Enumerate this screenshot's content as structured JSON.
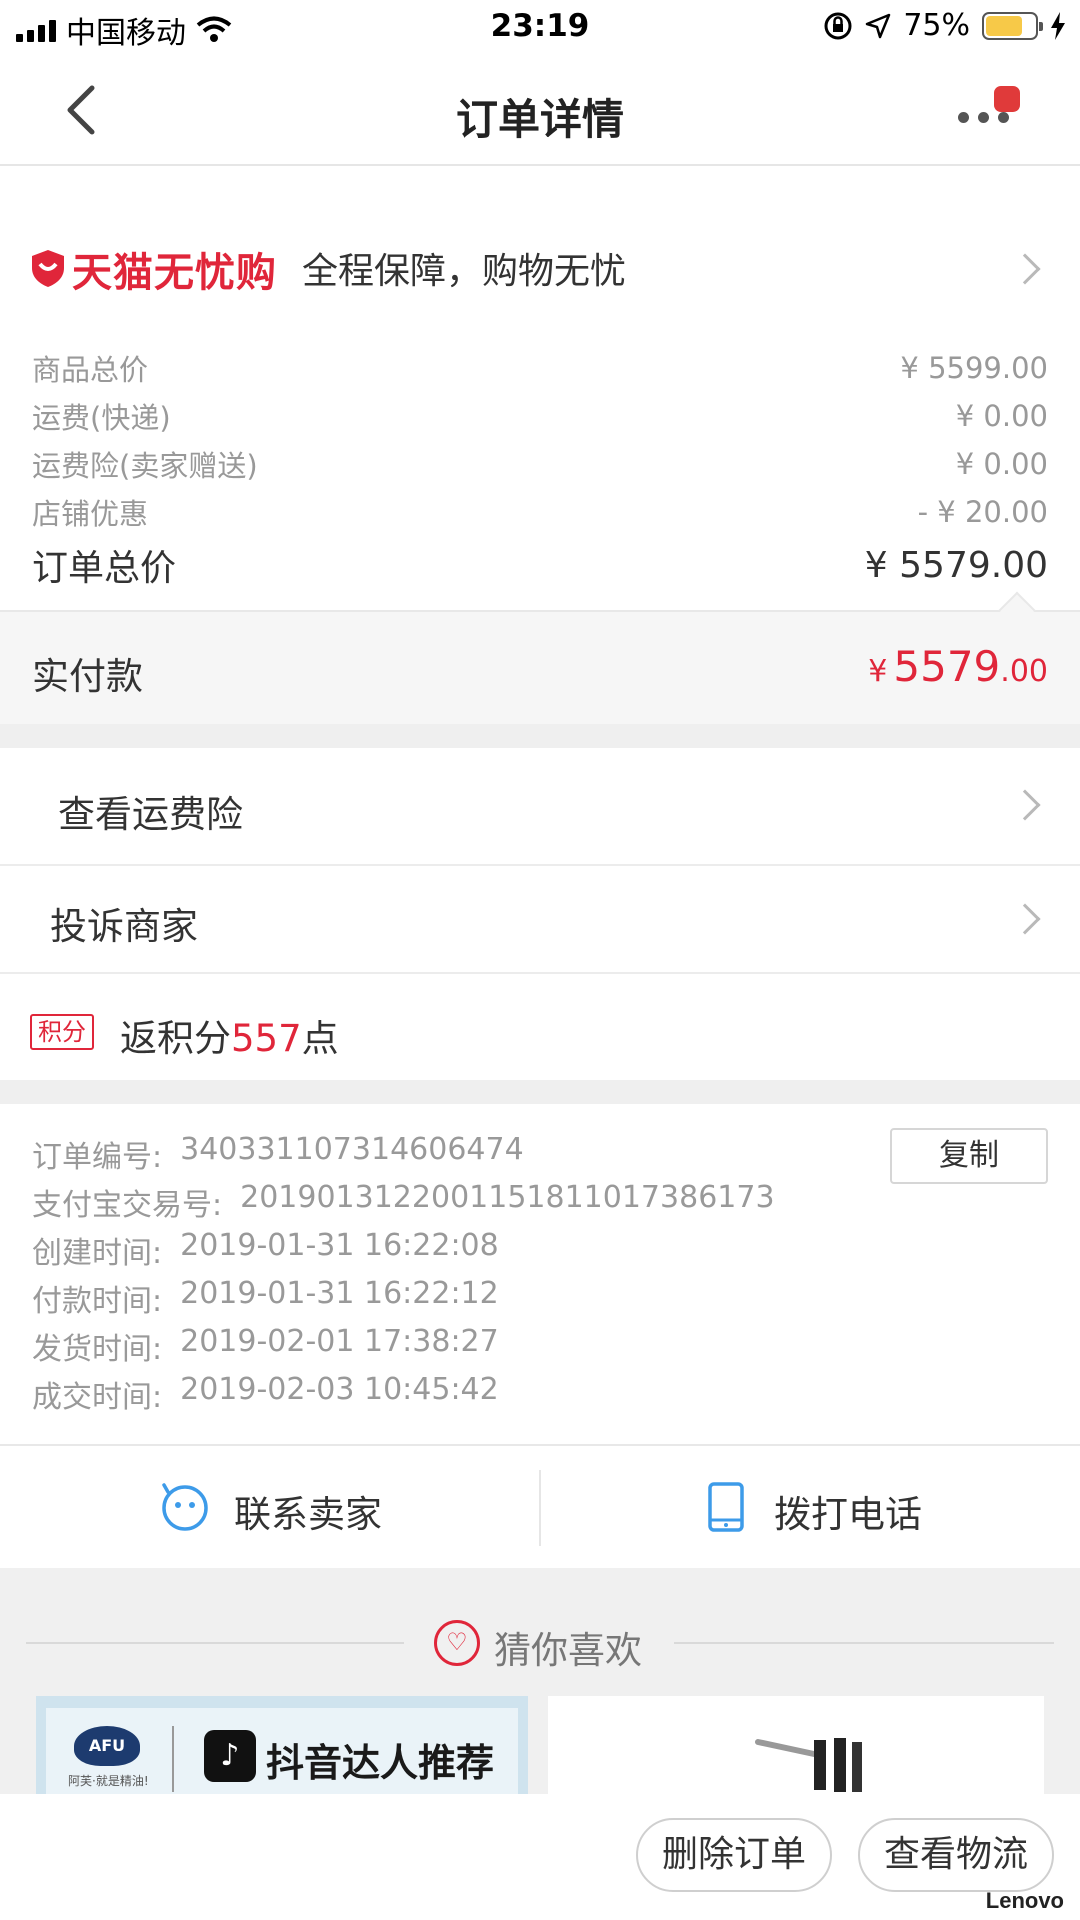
{
  "statusbar": {
    "carrier": "中国移动",
    "time": "23:19",
    "battery": "75%",
    "battery_level": 0.75
  },
  "nav": {
    "title": "订单详情"
  },
  "guarantee": {
    "brand": "天猫无忧购",
    "text": "全程保障，购物无忧"
  },
  "prices": [
    {
      "label": "商品总价",
      "value": "¥ 5599.00"
    },
    {
      "label": "运费(快递)",
      "value": "¥ 0.00"
    },
    {
      "label": "运费险(卖家赠送)",
      "value": "¥ 0.00"
    },
    {
      "label": "店铺优惠",
      "value": "- ¥ 20.00"
    }
  ],
  "order_total": {
    "label": "订单总价",
    "value": "¥ 5579.00"
  },
  "paid": {
    "label": "实付款",
    "currency": "¥",
    "integer": "5579",
    "decimal": ".00"
  },
  "rows": {
    "shipping_insurance": "查看运费险",
    "complain": "投诉商家"
  },
  "points": {
    "tag": "积分",
    "prefix": "返积分",
    "number": "557",
    "suffix": "点"
  },
  "order_info": {
    "copy_label": "复制",
    "lines": [
      {
        "k": "订单编号:",
        "v": "340331107314606474"
      },
      {
        "k": "支付宝交易号:",
        "v": "2019013122001151811017386173"
      },
      {
        "k": "创建时间:",
        "v": "2019-01-31 16:22:08"
      },
      {
        "k": "付款时间:",
        "v": "2019-01-31 16:22:12"
      },
      {
        "k": "发货时间:",
        "v": "2019-02-01 17:38:27"
      },
      {
        "k": "成交时间:",
        "v": "2019-02-03 10:45:42"
      }
    ]
  },
  "contact": {
    "seller": "联系卖家",
    "phone": "拨打电话"
  },
  "recommend": {
    "title": "猜你喜欢",
    "card1_logo": "AFU",
    "card1_logo_sub": "阿芙·就是精油!",
    "card1_text": "抖音达人推荐"
  },
  "actions": {
    "delete": "删除订单",
    "logistics": "查看物流"
  },
  "brand_mark": "Lenovo",
  "colors": {
    "accent": "#e0263a",
    "link_blue": "#3d9be9"
  }
}
